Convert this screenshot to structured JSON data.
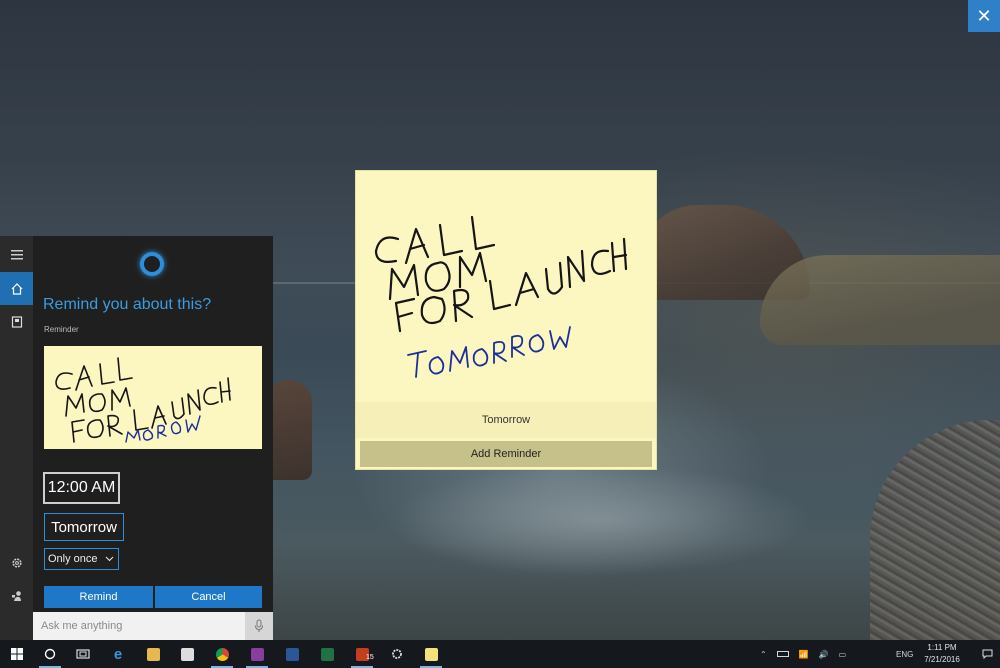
{
  "window": {
    "close_icon": "close-icon"
  },
  "note": {
    "handwriting_lines": [
      "CALL",
      "MOM",
      "FOR LAUNCH",
      "TOMORROW"
    ],
    "date_label": "Tomorrow",
    "add_reminder_label": "Add Reminder"
  },
  "cortana": {
    "title": "Remind you about this?",
    "subtitle": "Reminder",
    "time_value": "12:00 AM",
    "date_value": "Tomorrow",
    "repeat_value": "Only once",
    "remind_label": "Remind",
    "cancel_label": "Cancel",
    "ask_placeholder": "Ask me anything",
    "rail": {
      "menu_icon": "hamburger-icon",
      "home_icon": "home-icon",
      "notebook_icon": "notebook-icon",
      "settings_icon": "gear-icon",
      "feedback_icon": "feedback-icon"
    }
  },
  "taskbar": {
    "apps": [
      "start",
      "search",
      "task-view",
      "edge",
      "file-explorer",
      "store",
      "chrome",
      "onenote",
      "word",
      "excel",
      "powerpoint",
      "settings",
      "sticky-notes"
    ],
    "ppt_badge": "15",
    "language": "ENG",
    "time": "1:11 PM",
    "date": "7/21/2016"
  },
  "colors": {
    "accent": "#2e8fd8",
    "note_yellow": "#fcf7c1",
    "ink_black": "#151515",
    "ink_blue": "#1a2f9a"
  }
}
